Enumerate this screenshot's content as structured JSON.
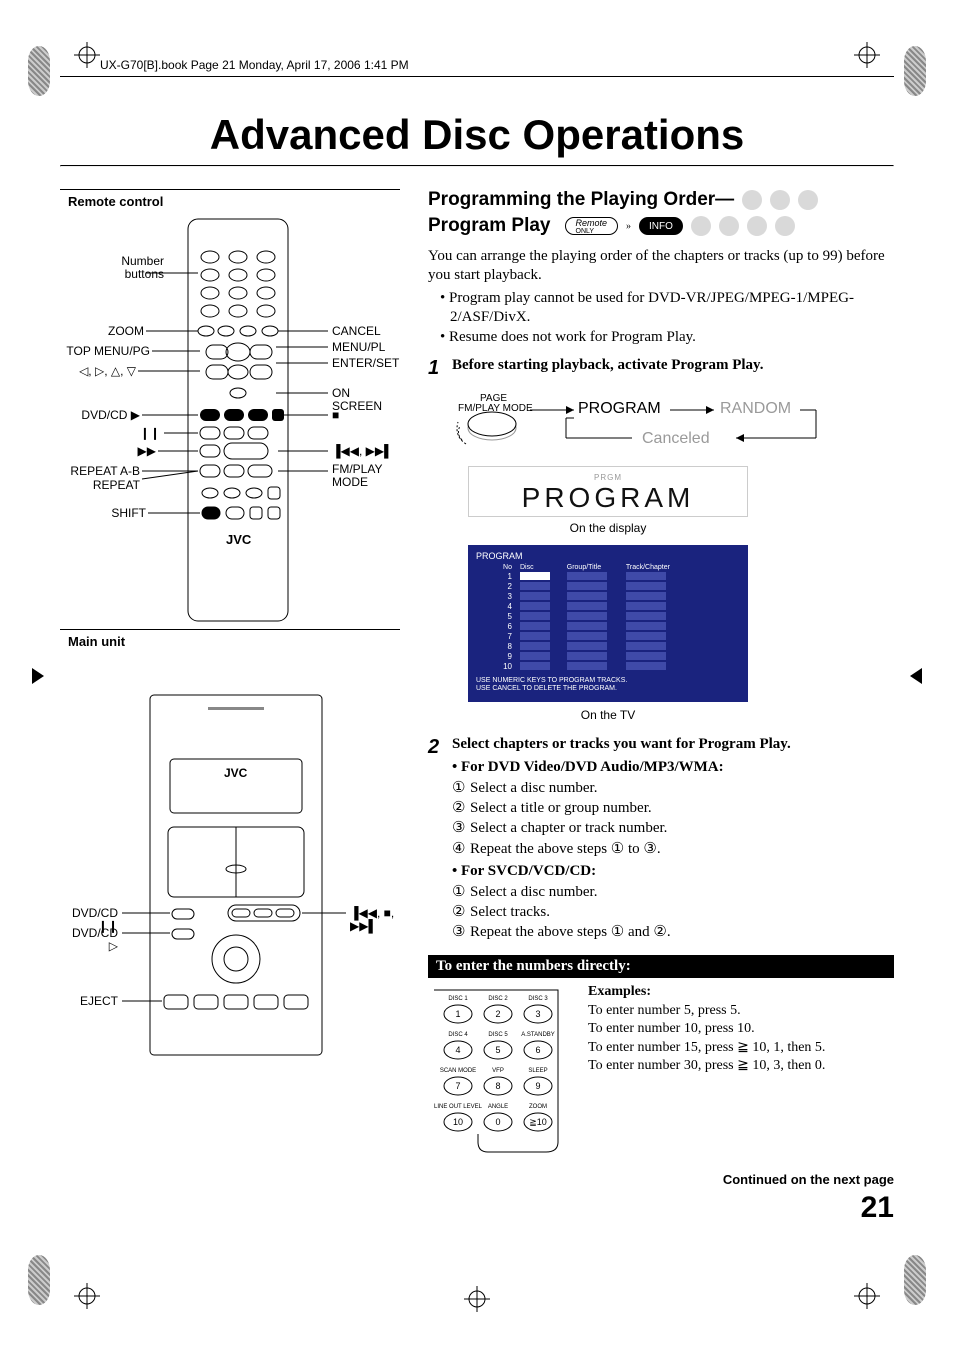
{
  "meta": {
    "header_line": "UX-G70[B].book  Page 21  Monday, April 17, 2006  1:41 PM",
    "title": "Advanced Disc Operations",
    "page_number": "21",
    "continued": "Continued on the next page"
  },
  "left": {
    "remote_label": "Remote control",
    "main_unit_label": "Main unit",
    "remote_callouts_left": [
      "Number\nbuttons",
      "ZOOM",
      "TOP MENU/PG",
      "◁, ▷, △, ▽",
      "DVD/CD ▶",
      "❙❙",
      "▶▶",
      "REPEAT A-B",
      "REPEAT",
      "SHIFT"
    ],
    "remote_callouts_right": [
      "CANCEL",
      "MENU/PL",
      "ENTER/SET",
      "ON SCREEN",
      "■",
      "▐◀◀, ▶▶▌",
      "FM/PLAY\nMODE"
    ],
    "jvc_brand": "JVC",
    "main_callouts_left": [
      "DVD/CD ❙❙",
      "DVD/CD ▷",
      "EJECT"
    ],
    "main_callouts_right": "▐◀◀, ■, ▶▶▌"
  },
  "right": {
    "subhead_line1": "Programming the Playing Order—",
    "subhead_line2": "Program Play",
    "badge_remote": "Remote",
    "badge_remote_sub": "ONLY",
    "badge_info": "INFO",
    "intro": "You can arrange the playing order of the chapters or tracks (up to 99) before you start playback.",
    "bullets": [
      "Program play cannot be used for DVD-VR/JPEG/MPEG-1/MPEG-2/ASF/DivX.",
      "Resume does not work for Program Play."
    ],
    "step1": {
      "num": "1",
      "text": "Before starting playback, activate Program Play.",
      "mode_btn_top": "PAGE",
      "mode_btn_mid": "FM/PLAY MODE",
      "state_program": "PROGRAM",
      "state_random": "RANDOM",
      "state_canceled": "Canceled",
      "display_prgm": "PRGM",
      "display_text": "PROGRAM",
      "on_display": "On the display",
      "on_tv": "On the TV",
      "tv": {
        "title": "PROGRAM",
        "cols": [
          "No",
          "Disc",
          "Group/Title",
          "Track/Chapter"
        ],
        "rows": [
          1,
          2,
          3,
          4,
          5,
          6,
          7,
          8,
          9,
          10
        ],
        "footer1": "USE NUMERIC KEYS TO PROGRAM TRACKS.",
        "footer2": "USE CANCEL TO DELETE THE PROGRAM."
      }
    },
    "step2": {
      "num": "2",
      "text": "Select chapters or tracks you want for Program Play.",
      "sub1": "• For DVD Video/DVD Audio/MP3/WMA:",
      "list1": [
        "Select a disc number.",
        "Select a title or group number.",
        "Select a chapter or track number.",
        "Repeat the above steps ① to ③."
      ],
      "sub2": "• For SVCD/VCD/CD:",
      "list2": [
        "Select a disc number.",
        "Select tracks.",
        "Repeat the above steps ① and ②."
      ]
    },
    "blackbar": "To enter the numbers directly:",
    "keypad": {
      "row_labels": [
        "DISC 1",
        "DISC 2",
        "DISC 3",
        "DISC 4",
        "DISC 5",
        "A.STANDBY",
        "SCAN MODE",
        "VFP",
        "SLEEP",
        "LINE OUT LEVEL",
        "ANGLE",
        "ZOOM"
      ],
      "keys": [
        "1",
        "2",
        "3",
        "4",
        "5",
        "6",
        "7",
        "8",
        "9",
        "10",
        "0",
        "≧10"
      ]
    },
    "examples": {
      "hd": "Examples:",
      "lines": [
        "To enter number 5, press 5.",
        "To enter number 10, press 10.",
        "To enter number 15, press  ≧ 10, 1, then 5.",
        "To enter number 30, press  ≧ 10, 3, then 0."
      ]
    }
  }
}
